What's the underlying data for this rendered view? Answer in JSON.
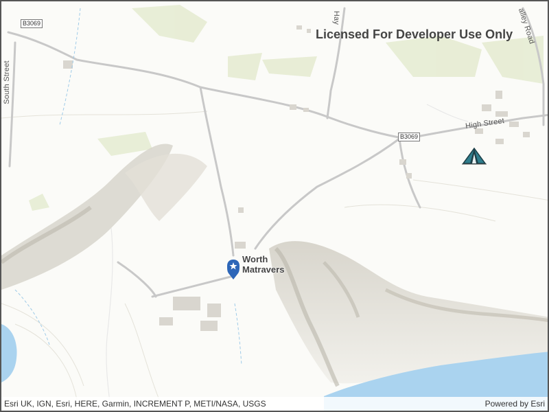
{
  "watermark": "Licensed For Developer Use Only",
  "place": {
    "line1": "Worth",
    "line2": "Matravers"
  },
  "roads": {
    "b3069_west": "B3069",
    "b3069_east": "B3069",
    "high_street": "High Street",
    "south_street": "South Street",
    "hay": "Hay",
    "valley_road": "alley Road"
  },
  "attribution": "Esri UK, IGN, Esri, HERE, Garmin, INCREMENT P, METI/NASA, USGS",
  "powered_by": "Powered by Esri",
  "icons": {
    "marker": "map-pin-star-icon",
    "tent": "campsite-tent-icon"
  },
  "colors": {
    "pin": "#2d66b8",
    "water": "#aad3ef",
    "road": "#cfcfcf",
    "hillshade": "#c9c6bd"
  }
}
